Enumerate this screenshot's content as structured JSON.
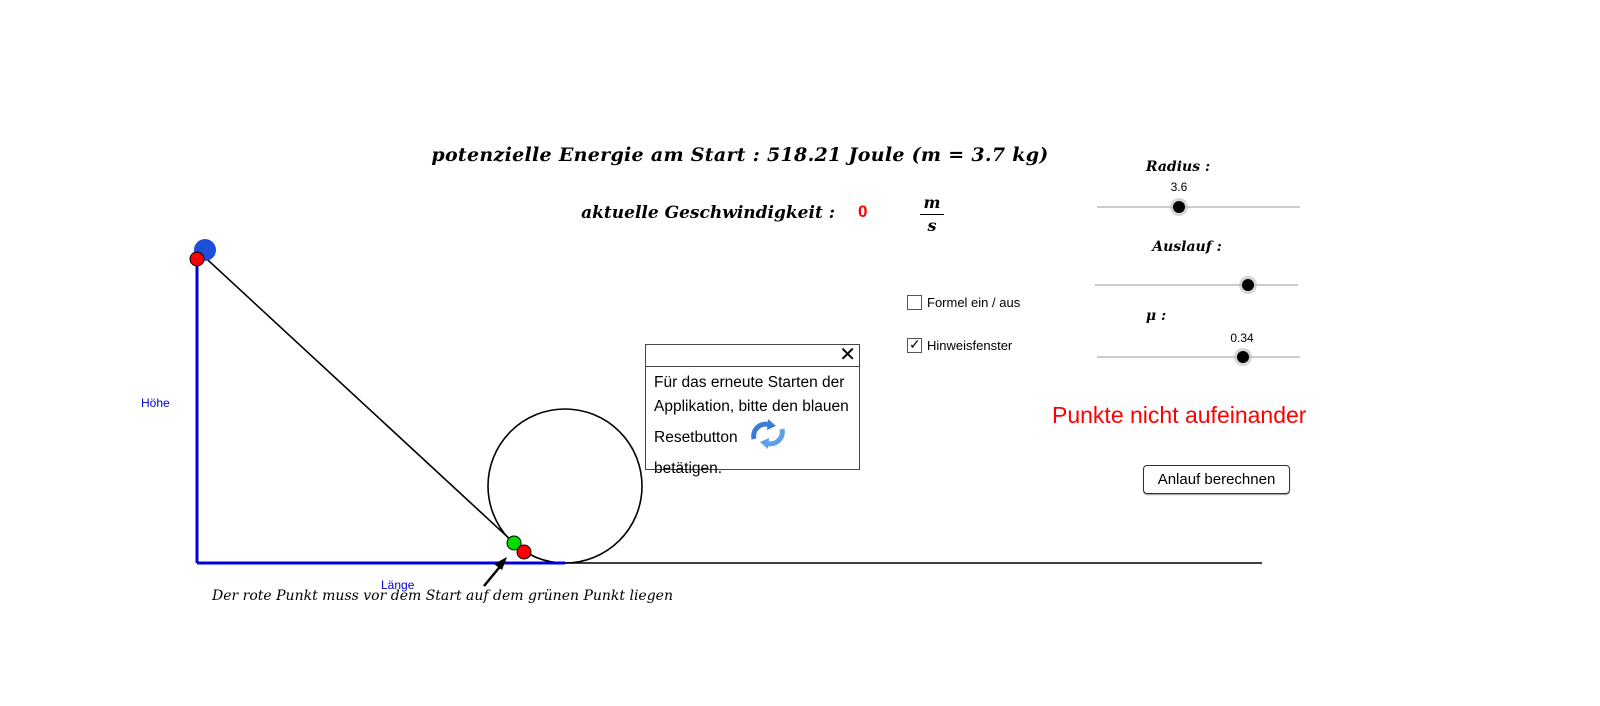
{
  "energy_title": "potenzielle Energie am Start : 518.21 Joule (m = 3.7 kg)",
  "speed": {
    "label": "aktuelle Geschwindigkeit :",
    "value": "0",
    "unit_numerator": "m",
    "unit_denominator": "s"
  },
  "sliders": [
    {
      "label": "Radius :",
      "value": "3.6",
      "position": 0.4
    },
    {
      "label": "Auslauf :",
      "value": "",
      "position": 0.75
    },
    {
      "label": "μ :",
      "value": "0.34",
      "position": 0.72
    }
  ],
  "checkboxes": [
    {
      "label": "Formel ein / aus",
      "checked": false
    },
    {
      "label": "Hinweisfenster",
      "checked": true
    }
  ],
  "status_message": "Punkte nicht aufeinander",
  "calculate_button": "Anlauf berechnen",
  "hint_window": {
    "close_symbol": "✕",
    "lines": [
      "Für das erneute Starten der",
      "Applikation, bitte den blauen",
      "Resetbutton",
      "betätigen."
    ]
  },
  "axis_labels": {
    "height": "Höhe",
    "length": "Länge"
  },
  "footnote": "Der rote Punkt muss vor dem Start auf dem grünen Punkt liegen",
  "colors": {
    "axis": "#0000dd",
    "start_ball": "#1e4fd8",
    "red_point": "#ff0000",
    "green_point": "#00dd00",
    "warning": "#ff0000"
  },
  "icons": {
    "close": "close-icon",
    "reset": "refresh-icon"
  }
}
